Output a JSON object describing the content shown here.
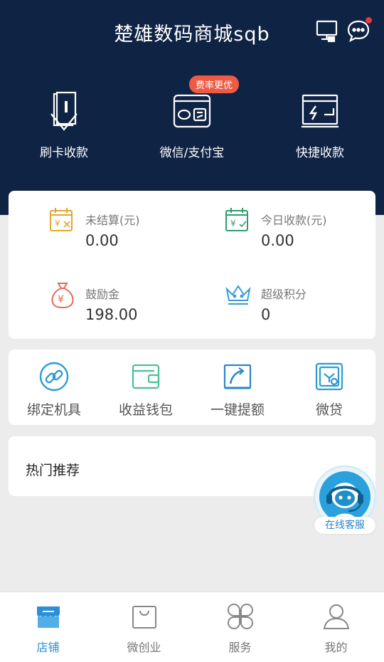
{
  "header": {
    "title": "楚雄数码商城sqb",
    "icons": [
      "monitor-icon",
      "chat-icon"
    ],
    "has_notification": true,
    "background": "#0f2344"
  },
  "quick_actions": [
    {
      "label": "刷卡收款",
      "icon": "card-swipe-icon"
    },
    {
      "label": "微信/支付宝",
      "icon": "wechat-alipay-icon",
      "badge": "费率更优"
    },
    {
      "label": "快捷收款",
      "icon": "quick-pay-icon"
    }
  ],
  "stats": [
    {
      "label": "未结算(元)",
      "value": "0.00",
      "icon": "unsettled-calendar-icon",
      "color": "#e3a630"
    },
    {
      "label": "今日收款(元)",
      "value": "0.00",
      "icon": "today-calendar-icon",
      "color": "#2e9d6a"
    },
    {
      "label": "鼓励金",
      "value": "198.00",
      "icon": "money-bag-icon",
      "color": "#e26b5b"
    },
    {
      "label": "超级积分",
      "value": "0",
      "icon": "crown-icon",
      "color": "#3b9ad9"
    }
  ],
  "services": [
    {
      "label": "绑定机具",
      "icon": "link-icon"
    },
    {
      "label": "收益钱包",
      "icon": "wallet-icon"
    },
    {
      "label": "一键提额",
      "icon": "raise-limit-icon"
    },
    {
      "label": "微贷",
      "icon": "micro-loan-icon"
    }
  ],
  "recommend": {
    "title": "热门推荐"
  },
  "customer_service": {
    "label": "在线客服"
  },
  "tabbar": [
    {
      "label": "店铺",
      "icon": "store-icon",
      "active": true
    },
    {
      "label": "微创业",
      "icon": "bag-icon",
      "active": false
    },
    {
      "label": "服务",
      "icon": "grid-icon",
      "active": false
    },
    {
      "label": "我的",
      "icon": "user-icon",
      "active": false
    }
  ],
  "colors": {
    "accent": "#2a8fd6",
    "badge": "#ee5a43"
  }
}
